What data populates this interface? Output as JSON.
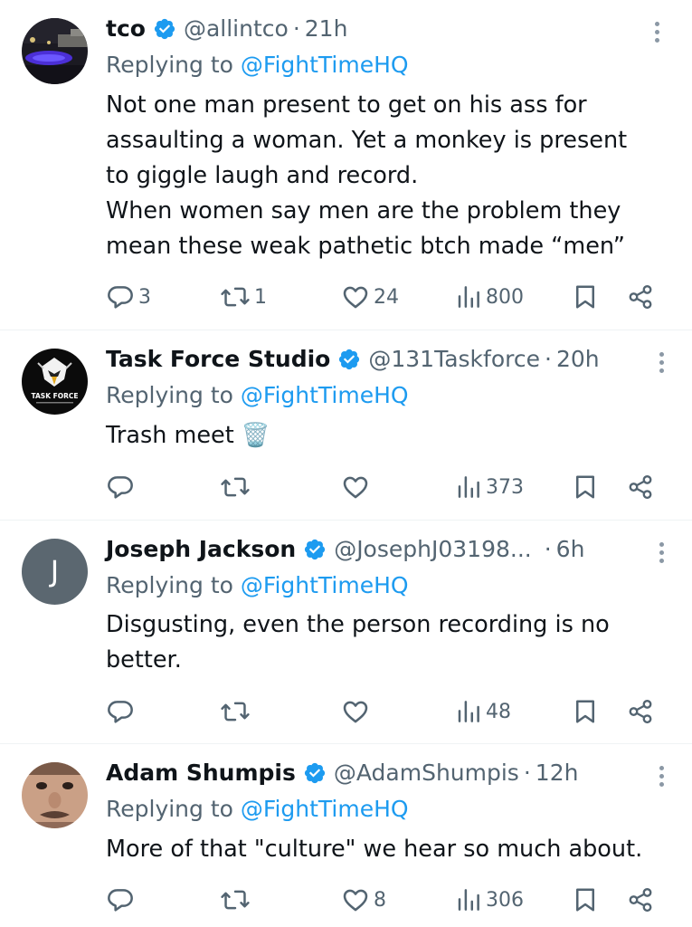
{
  "tweets": [
    {
      "name": "tco",
      "handle": "@allintco",
      "time": "21h",
      "replying_prefix": "Replying to ",
      "replying_to": "@FightTimeHQ",
      "body_lines": [
        "Not one man present to get on his ass for",
        "assaulting a woman. Yet a monkey is present",
        "to giggle laugh and record.",
        "When women say men are the problem they",
        "mean these weak pathetic btch made “men”"
      ],
      "replies": "3",
      "retweets": "1",
      "likes": "24",
      "views": "800",
      "avatar": "night-pool-photo"
    },
    {
      "name": "Task Force Studio",
      "handle": "@131Taskforce",
      "time": "20h",
      "replying_prefix": "Replying to ",
      "replying_to": "@FightTimeHQ",
      "body_lines": [
        "Trash meet 🗑️"
      ],
      "replies": "",
      "retweets": "",
      "likes": "",
      "views": "373",
      "avatar": "task-force-eagle-logo",
      "avatar_text": "TASK FORCE"
    },
    {
      "name": "Joseph Jackson",
      "handle": "@JosephJ03198...",
      "time": "6h",
      "replying_prefix": "Replying to ",
      "replying_to": "@FightTimeHQ",
      "body_lines": [
        "Disgusting, even the person recording is no",
        "better."
      ],
      "replies": "",
      "retweets": "",
      "likes": "",
      "views": "48",
      "avatar": "letter-avatar",
      "avatar_text": "J"
    },
    {
      "name": "Adam Shumpis",
      "handle": "@AdamShumpis",
      "time": "12h",
      "replying_prefix": "Replying to ",
      "replying_to": "@FightTimeHQ",
      "body_lines": [
        "More of that \"culture\" we hear so much about."
      ],
      "replies": "",
      "retweets": "",
      "likes": "8",
      "views": "306",
      "avatar": "face-photo"
    }
  ],
  "dot_separator": "·",
  "colors": {
    "text": "#0f1419",
    "secondary": "#536471",
    "link": "#1d9bf0",
    "verified": "#1d9bf0",
    "divider": "#eff3f4"
  },
  "icons": [
    "verified-badge-icon",
    "more-options-icon",
    "reply-icon",
    "retweet-icon",
    "like-icon",
    "views-icon",
    "bookmark-icon",
    "share-icon"
  ]
}
